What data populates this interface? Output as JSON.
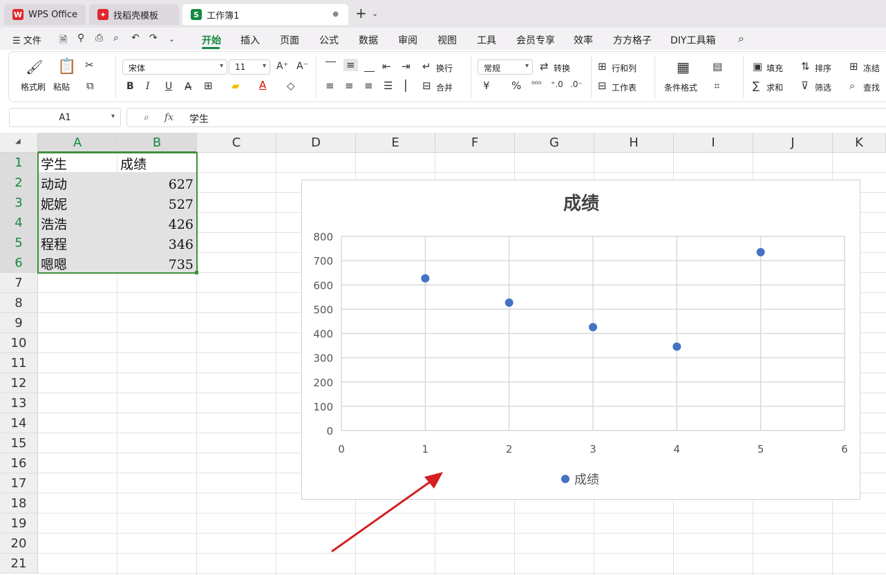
{
  "tabs": {
    "wps": "WPS Office",
    "templates": "找稻壳模板",
    "workbook": "工作簿1"
  },
  "menu": {
    "file": "文件",
    "items": [
      "开始",
      "插入",
      "页面",
      "公式",
      "数据",
      "审阅",
      "视图",
      "工具",
      "会员专享",
      "效率",
      "方方格子",
      "DIY工具箱"
    ]
  },
  "ribbon": {
    "format_painter": "格式刷",
    "paste": "粘贴",
    "font_name": "宋体",
    "font_size": "11",
    "wrap": "换行",
    "merge": "合并",
    "number_format": "常规",
    "convert": "转换",
    "rows_cols": "行和列",
    "worksheet": "工作表",
    "cond_format": "条件格式",
    "fill": "填充",
    "sort": "排序",
    "freeze": "冻结",
    "sum": "求和",
    "filter": "筛选",
    "find": "查找",
    "bold": "B",
    "italic": "I",
    "underline": "U",
    "currency": "¥",
    "percent": "%"
  },
  "formula_bar": {
    "name_box": "A1",
    "fx_label": "fx",
    "content": "学生"
  },
  "columns": [
    "A",
    "B",
    "C",
    "D",
    "E",
    "F",
    "G",
    "H",
    "I",
    "J",
    "K"
  ],
  "rows": [
    "1",
    "2",
    "3",
    "4",
    "5",
    "6",
    "7",
    "8",
    "9",
    "10",
    "11",
    "12",
    "13",
    "14",
    "15",
    "16",
    "17",
    "18",
    "19",
    "20",
    "21"
  ],
  "cells": {
    "header": [
      "学生",
      "成绩"
    ],
    "data": [
      [
        "动动",
        "627"
      ],
      [
        "妮妮",
        "527"
      ],
      [
        "浩浩",
        "426"
      ],
      [
        "程程",
        "346"
      ],
      [
        "嗯嗯",
        "735"
      ]
    ]
  },
  "colors": {
    "accent": "#148a3f",
    "selection": "#3f8f3a",
    "marker": "#4472c4",
    "arrow": "#d42020"
  },
  "chart_data": {
    "type": "scatter",
    "title": "成绩",
    "x": [
      1,
      2,
      3,
      4,
      5
    ],
    "series": [
      {
        "name": "成绩",
        "values": [
          627,
          527,
          426,
          346,
          735
        ]
      }
    ],
    "xlim": [
      0,
      6
    ],
    "ylim": [
      0,
      800
    ],
    "xticks": [
      "0",
      "1",
      "2",
      "3",
      "4",
      "5",
      "6"
    ],
    "yticks": [
      "0",
      "100",
      "200",
      "300",
      "400",
      "500",
      "600",
      "700",
      "800"
    ],
    "grid": true,
    "legend": "bottom"
  }
}
